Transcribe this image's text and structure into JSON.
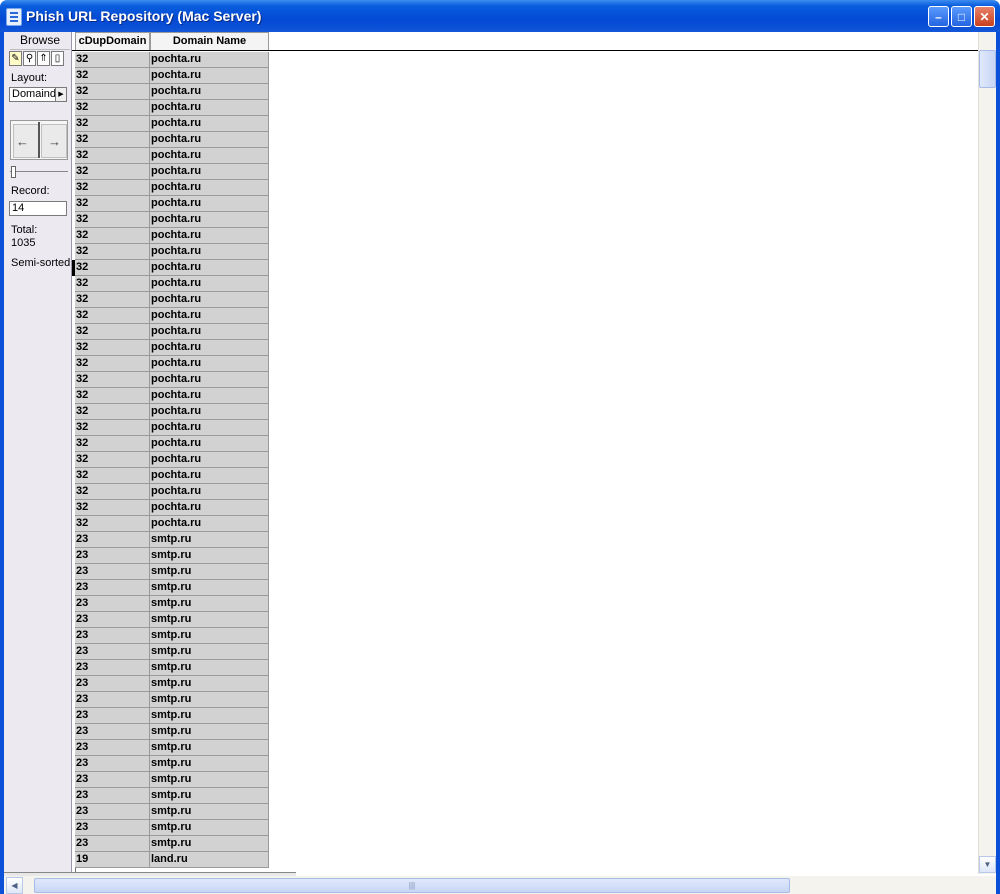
{
  "window": {
    "title": "Phish URL Repository (Mac Server)",
    "minimize": "–",
    "maximize": "□",
    "close": "✕"
  },
  "status_area": {
    "mode": "Browse",
    "layout_label": "Layout:",
    "layout_value": "Domaind",
    "record_label": "Record:",
    "record_value": "14",
    "total_label": "Total:",
    "total_value": "1035",
    "sort_status": "Semi-sorted"
  },
  "table": {
    "columns": [
      "cDupDomain",
      "Domain Name"
    ],
    "current_row": 13,
    "rows": [
      [
        "32",
        "pochta.ru"
      ],
      [
        "32",
        "pochta.ru"
      ],
      [
        "32",
        "pochta.ru"
      ],
      [
        "32",
        "pochta.ru"
      ],
      [
        "32",
        "pochta.ru"
      ],
      [
        "32",
        "pochta.ru"
      ],
      [
        "32",
        "pochta.ru"
      ],
      [
        "32",
        "pochta.ru"
      ],
      [
        "32",
        "pochta.ru"
      ],
      [
        "32",
        "pochta.ru"
      ],
      [
        "32",
        "pochta.ru"
      ],
      [
        "32",
        "pochta.ru"
      ],
      [
        "32",
        "pochta.ru"
      ],
      [
        "32",
        "pochta.ru"
      ],
      [
        "32",
        "pochta.ru"
      ],
      [
        "32",
        "pochta.ru"
      ],
      [
        "32",
        "pochta.ru"
      ],
      [
        "32",
        "pochta.ru"
      ],
      [
        "32",
        "pochta.ru"
      ],
      [
        "32",
        "pochta.ru"
      ],
      [
        "32",
        "pochta.ru"
      ],
      [
        "32",
        "pochta.ru"
      ],
      [
        "32",
        "pochta.ru"
      ],
      [
        "32",
        "pochta.ru"
      ],
      [
        "32",
        "pochta.ru"
      ],
      [
        "32",
        "pochta.ru"
      ],
      [
        "32",
        "pochta.ru"
      ],
      [
        "32",
        "pochta.ru"
      ],
      [
        "32",
        "pochta.ru"
      ],
      [
        "32",
        "pochta.ru"
      ],
      [
        "23",
        "smtp.ru"
      ],
      [
        "23",
        "smtp.ru"
      ],
      [
        "23",
        "smtp.ru"
      ],
      [
        "23",
        "smtp.ru"
      ],
      [
        "23",
        "smtp.ru"
      ],
      [
        "23",
        "smtp.ru"
      ],
      [
        "23",
        "smtp.ru"
      ],
      [
        "23",
        "smtp.ru"
      ],
      [
        "23",
        "smtp.ru"
      ],
      [
        "23",
        "smtp.ru"
      ],
      [
        "23",
        "smtp.ru"
      ],
      [
        "23",
        "smtp.ru"
      ],
      [
        "23",
        "smtp.ru"
      ],
      [
        "23",
        "smtp.ru"
      ],
      [
        "23",
        "smtp.ru"
      ],
      [
        "23",
        "smtp.ru"
      ],
      [
        "23",
        "smtp.ru"
      ],
      [
        "23",
        "smtp.ru"
      ],
      [
        "23",
        "smtp.ru"
      ],
      [
        "23",
        "smtp.ru"
      ],
      [
        "19",
        "land.ru"
      ]
    ]
  },
  "icons": {
    "browse_tool": "pencil-icon",
    "find_tool": "magnifier-icon",
    "sort_tool": "sort-arrow-icon",
    "preview_tool": "page-icon",
    "book": "record-book-icon"
  }
}
